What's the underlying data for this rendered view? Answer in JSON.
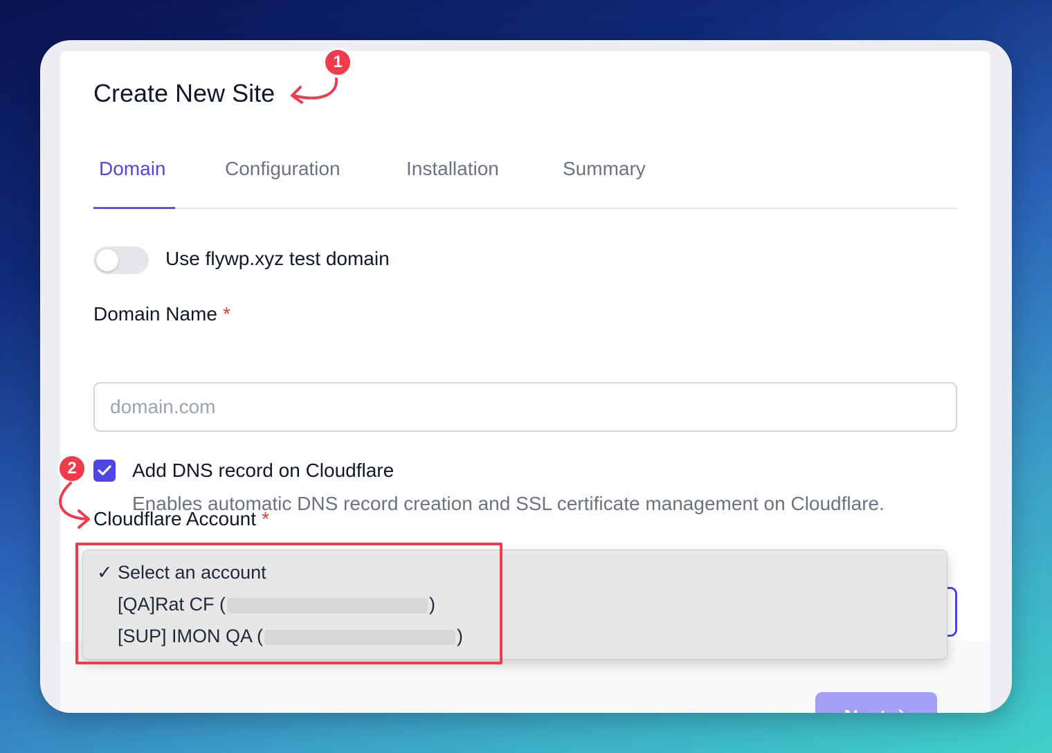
{
  "form": {
    "title": "Create New Site",
    "tabs": [
      {
        "label": "Domain",
        "active": true
      },
      {
        "label": "Configuration",
        "active": false
      },
      {
        "label": "Installation",
        "active": false
      },
      {
        "label": "Summary",
        "active": false
      }
    ],
    "toggle_label": "Use flywp.xyz test domain",
    "toggle_on": false,
    "domain_label": "Domain Name",
    "required_mark": "*",
    "domain_placeholder": "domain.com",
    "domain_value": "",
    "dns_checkbox_label": "Add DNS record on Cloudflare",
    "dns_checked": true,
    "dns_description": "Enables automatic DNS record creation and SSL certificate management on Cloudflare.",
    "cloudflare_label": "Cloudflare Account",
    "next_label": "Next"
  },
  "dropdown": {
    "check_mark": "✓",
    "items": [
      {
        "label": "Select an account",
        "selected": true
      },
      {
        "prefix": "[QA]Rat CF (",
        "suffix": ")"
      },
      {
        "prefix": "[SUP] IMON QA (",
        "suffix": ")"
      }
    ]
  },
  "annotations": {
    "step1": "1",
    "step2": "2"
  },
  "colors": {
    "accent": "#4f46e5",
    "annotation": "#ef3b4b",
    "next_disabled": "#a5a0f5"
  }
}
